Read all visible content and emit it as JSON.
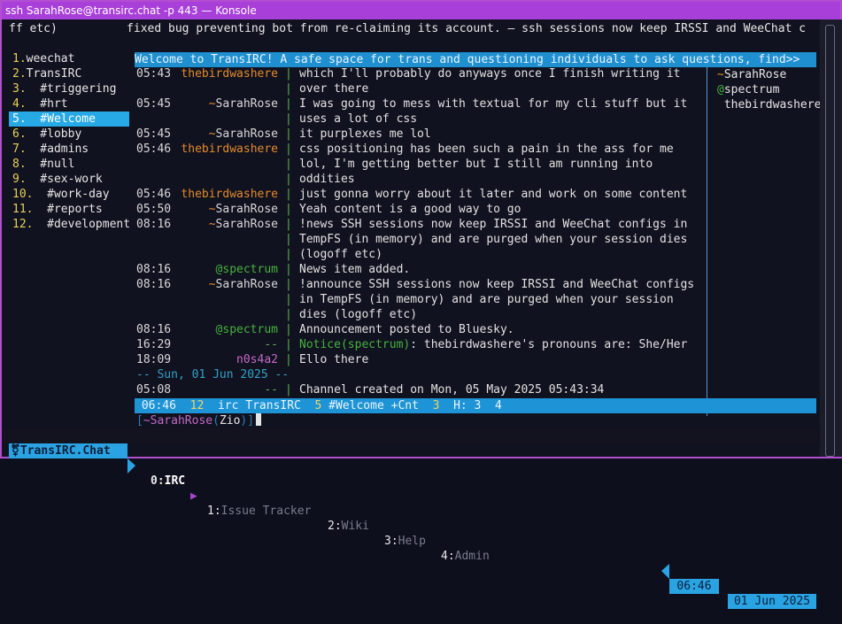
{
  "window": {
    "title": "ssh SarahRose@transirc.chat -p 443 — Konsole"
  },
  "topic_line": "ff etc)          fixed bug preventing bot from re-claiming its account. — ssh sessions now keep IRSSI and WeeChat c",
  "buffers": [
    {
      "num": "1.",
      "name": "weechat"
    },
    {
      "num": "2.",
      "name": "TransIRC"
    },
    {
      "num": "3.",
      "name": "  #triggering"
    },
    {
      "num": "4.",
      "name": "  #hrt"
    },
    {
      "num": "5.",
      "name": "  #Welcome"
    },
    {
      "num": "6.",
      "name": "  #lobby"
    },
    {
      "num": "7.",
      "name": "  #admins"
    },
    {
      "num": "8.",
      "name": "  #null"
    },
    {
      "num": "9.",
      "name": "  #sex-work"
    },
    {
      "num": "10.",
      "name": "  #work-day"
    },
    {
      "num": "11.",
      "name": "  #reports"
    },
    {
      "num": "12.",
      "name": "  #development"
    }
  ],
  "channel_topic": "Welcome to TransIRC! A safe space for trans and questioning individuals to ask questions, find>>",
  "messages": [
    {
      "time": "05:43",
      "nick": "thebirdwashere",
      "style": "orange",
      "lines": [
        "which I'll probably do anyways once I finish writing it",
        "over there"
      ]
    },
    {
      "time": "05:45",
      "nick": "SarahRose",
      "prefix": "~",
      "style": "sarah",
      "lines": [
        "I was going to mess with textual for my cli stuff but it",
        "uses a lot of css"
      ]
    },
    {
      "time": "05:45",
      "nick": "SarahRose",
      "prefix": "~",
      "style": "sarah",
      "lines": [
        "it purplexes me lol"
      ]
    },
    {
      "time": "05:46",
      "nick": "thebirdwashere",
      "style": "orange",
      "lines": [
        "css positioning has been such a pain in the ass for me",
        "lol, I'm getting better but I still am running into",
        "oddities"
      ]
    },
    {
      "time": "05:46",
      "nick": "thebirdwashere",
      "style": "orange",
      "lines": [
        "just gonna worry about it later and work on some content"
      ]
    },
    {
      "time": "05:50",
      "nick": "SarahRose",
      "prefix": "~",
      "style": "sarah",
      "lines": [
        "Yeah content is a good way to go"
      ]
    },
    {
      "time": "08:16",
      "nick": "SarahRose",
      "prefix": "~",
      "style": "sarah",
      "lines": [
        "!news SSH sessions now keep IRSSI and WeeChat configs in",
        "TempFS (in memory) and are purged when your session dies",
        "(logoff etc)"
      ]
    },
    {
      "time": "08:16",
      "nick": "spectrum",
      "prefix": "@",
      "style": "spectrum",
      "lines": [
        "News item added."
      ]
    },
    {
      "time": "08:16",
      "nick": "SarahRose",
      "prefix": "~",
      "style": "sarah",
      "lines": [
        "!announce SSH sessions now keep IRSSI and WeeChat configs",
        "in TempFS (in memory) and are purged when your session",
        "dies (logoff etc)"
      ]
    },
    {
      "time": "08:16",
      "nick": "spectrum",
      "prefix": "@",
      "style": "spectrum",
      "lines": [
        "Announcement posted to Bluesky."
      ]
    },
    {
      "time": "16:29",
      "nick": "--",
      "style": "dash",
      "notice": "Notice(spectrum)",
      "lines": [
        ": thebirdwashere's pronouns are: She/Her"
      ]
    },
    {
      "time": "18:09",
      "nick": "n0s4a2",
      "style": "neos",
      "lines": [
        "Ello there"
      ]
    },
    {
      "day": "-- Sun, 01 Jun 2025 --"
    },
    {
      "time": "05:08",
      "nick": "--",
      "style": "dash",
      "lines": [
        "Channel created on Mon, 05 May 2025 05:43:34"
      ]
    }
  ],
  "nicklist": [
    {
      "prefix": "~",
      "name": "SarahRose"
    },
    {
      "prefix": "@",
      "name": "spectrum"
    },
    {
      "prefix": " ",
      "name": "thebirdwashere"
    }
  ],
  "status": {
    "time": "06:46",
    "buffer_num": "12",
    "server": "irc TransIRC",
    "channel_num": "5",
    "channel": "#Welcome",
    "modes": "+Cnt",
    "nicks": "3",
    "hotlist": "H: 3  4"
  },
  "input": {
    "prefix": "[",
    "nick": "~SarahRose",
    "mode": "Zio",
    "suffix": ")]"
  },
  "tmux": {
    "host": "TransIRC.Chat",
    "windows": [
      {
        "num": "0:",
        "name": "IRC"
      },
      {
        "num": "1:",
        "name": "Issue Tracker"
      },
      {
        "num": "2:",
        "name": "Wiki"
      },
      {
        "num": "3:",
        "name": "Help"
      },
      {
        "num": "4:",
        "name": "Admin"
      }
    ],
    "time": "06:46",
    "date": "01 Jun 2025"
  }
}
